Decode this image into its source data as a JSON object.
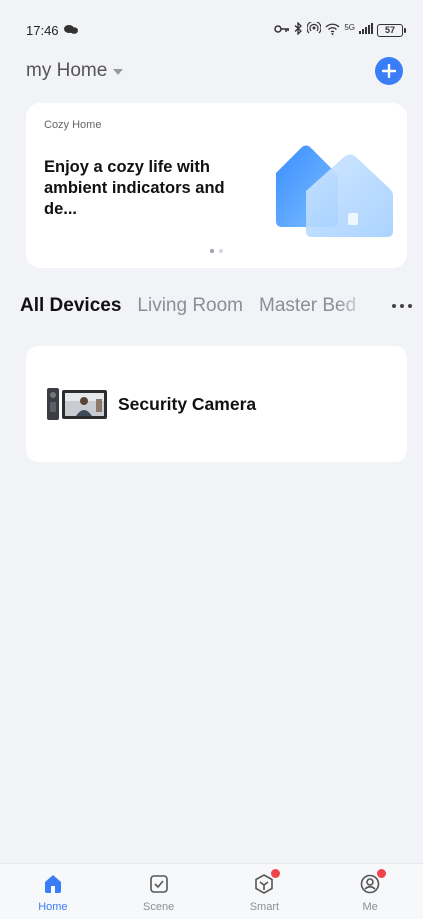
{
  "status_bar": {
    "time": "17:46",
    "network_label": "5G",
    "battery": "57"
  },
  "header": {
    "home_name": "my Home"
  },
  "banner": {
    "tag": "Cozy Home",
    "headline": "Enjoy a cozy life with ambient indicators and de...",
    "page_index": 1,
    "page_count": 2
  },
  "tabs": [
    {
      "label": "All Devices",
      "active": true
    },
    {
      "label": "Living Room",
      "active": false
    },
    {
      "label": "Master Bed",
      "active": false
    }
  ],
  "devices": [
    {
      "name": "Security Camera",
      "icon": "security-camera-thumbnail"
    }
  ],
  "bottom_nav": [
    {
      "label": "Home",
      "icon": "home-icon",
      "active": true,
      "badge": false
    },
    {
      "label": "Scene",
      "icon": "scene-checkbox-icon",
      "active": false,
      "badge": false
    },
    {
      "label": "Smart",
      "icon": "smart-cube-icon",
      "active": false,
      "badge": true
    },
    {
      "label": "Me",
      "icon": "profile-icon",
      "active": false,
      "badge": true
    }
  ],
  "colors": {
    "accent": "#3a7ef7",
    "badge": "#f0444b",
    "background": "#f2f3f7"
  }
}
